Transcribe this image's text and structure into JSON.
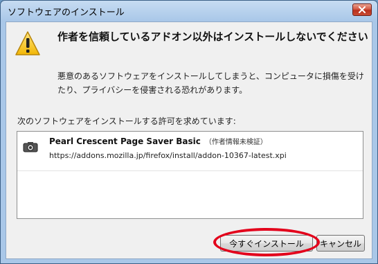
{
  "window": {
    "title": "ソフトウェアのインストール",
    "close_label": "×"
  },
  "warning": {
    "icon": "warning-triangle-icon",
    "heading": "作者を信頼しているアドオン以外はインストールしないでください",
    "description": "悪意のあるソフトウェアをインストールしてしまうと、コンピュータに損傷を受けたり、プライバシーを侵害される恐れがあります。"
  },
  "permission_text": "次のソフトウェアをインストールする許可を求めています:",
  "addons": [
    {
      "icon": "camera-icon",
      "name": "Pearl Crescent Page Saver Basic",
      "status": "（作者情報未検証）",
      "url": "https://addons.mozilla.jp/firefox/install/addon-10367-latest.xpi"
    }
  ],
  "buttons": {
    "install": "今すぐインストール",
    "cancel": "キャンセル"
  },
  "colors": {
    "highlight": "#e3001b",
    "titlebar": "#a9c7e8"
  }
}
